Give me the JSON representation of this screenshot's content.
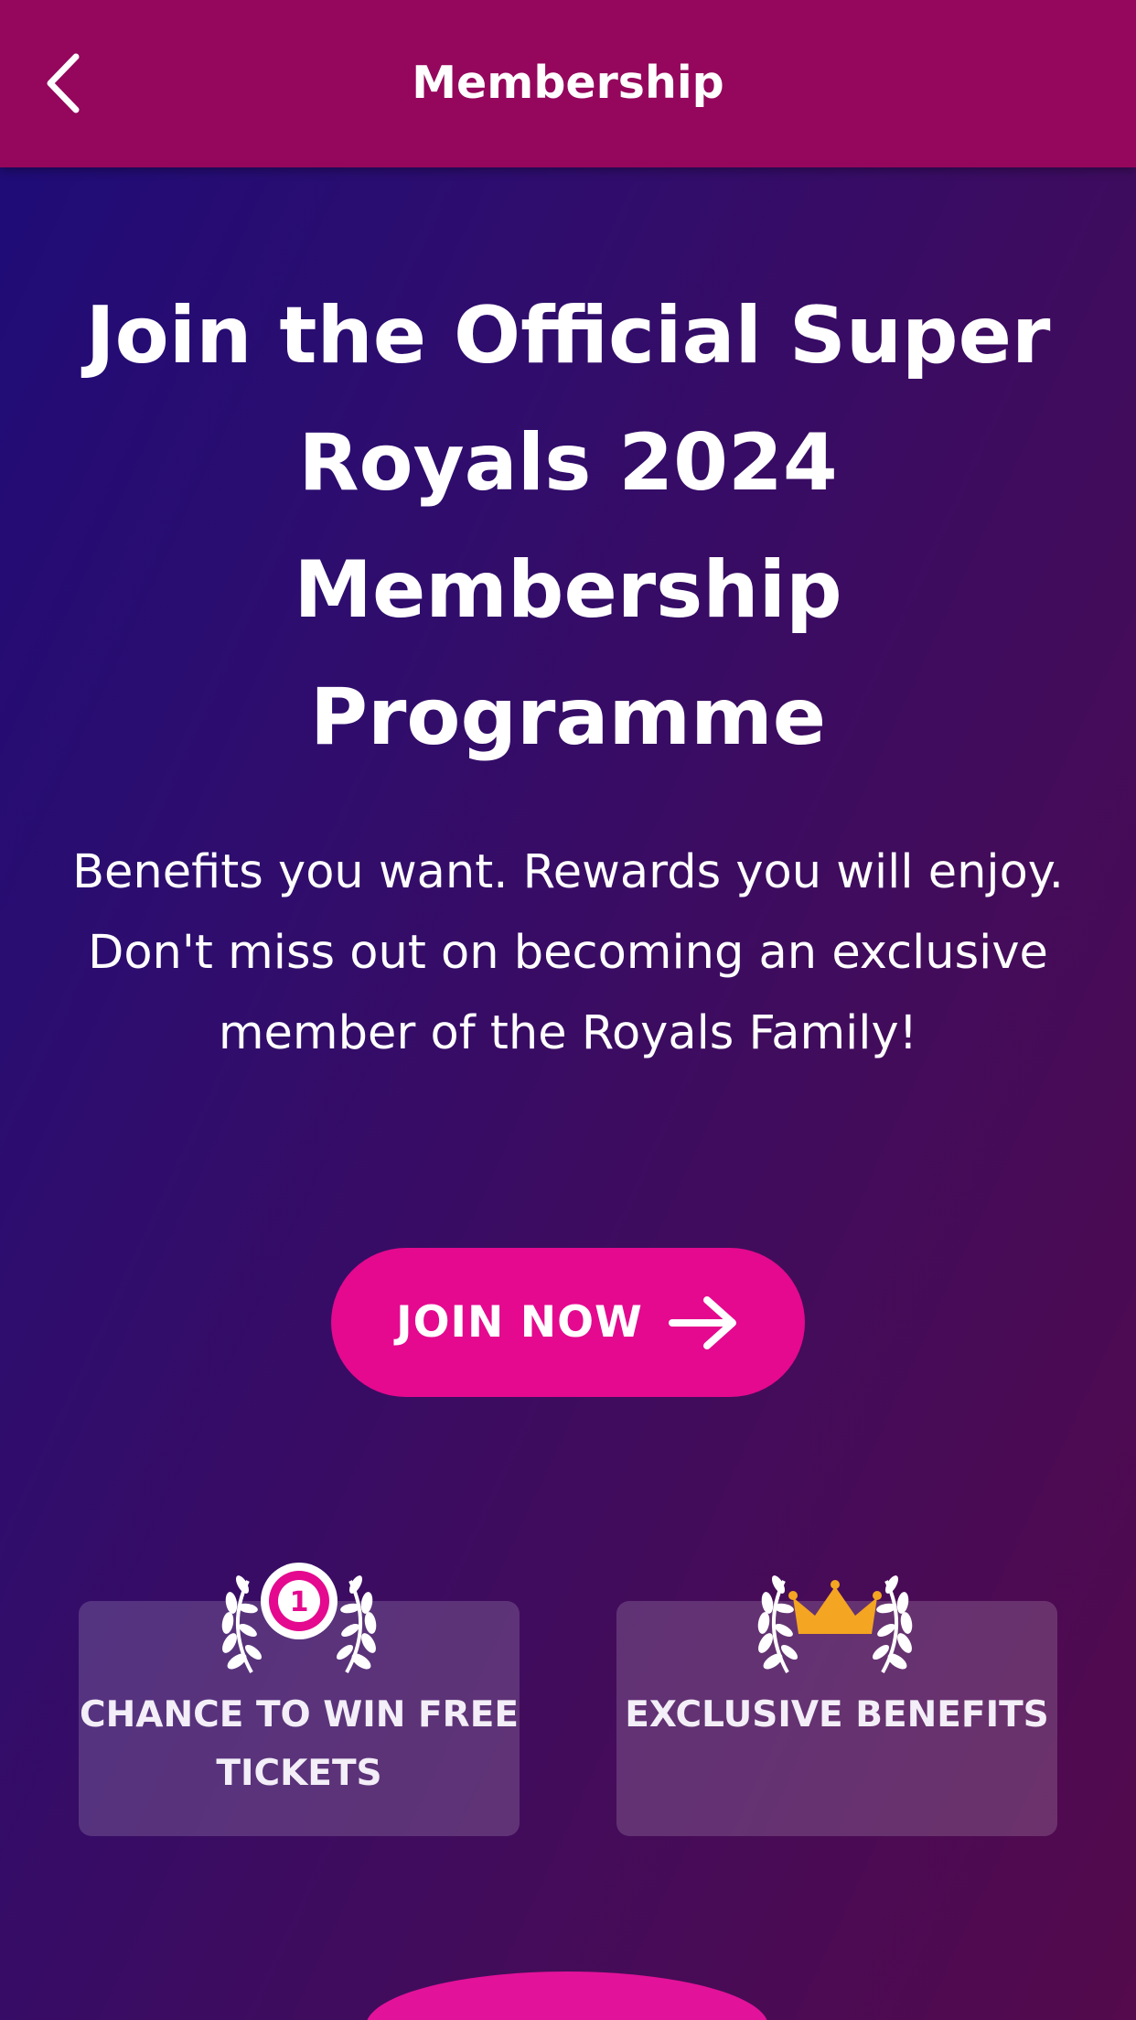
{
  "header": {
    "title": "Membership",
    "back_icon": "chevron-left-icon",
    "background_color": "#94075c"
  },
  "hero": {
    "title": "Join the Official Super Royals 2024 Membership Programme",
    "subtitle_line1": "Benefits you want. Rewards you will enjoy.",
    "subtitle_line2": "Don't miss out on becoming an exclusive member of the Royals Family!"
  },
  "cta": {
    "label": "JOIN NOW",
    "icon": "arrow-right-icon",
    "color": "#e4098f"
  },
  "features": [
    {
      "label": "CHANCE TO WIN FREE TICKETS",
      "badge_icon": "laurel-number-one-icon",
      "badge_text": "1"
    },
    {
      "label": "EXCLUSIVE BENEFITS",
      "badge_icon": "laurel-crown-icon"
    }
  ],
  "colors": {
    "gradient_start": "#1d0c78",
    "gradient_end": "#540a4c",
    "crown": "#f4a521"
  }
}
